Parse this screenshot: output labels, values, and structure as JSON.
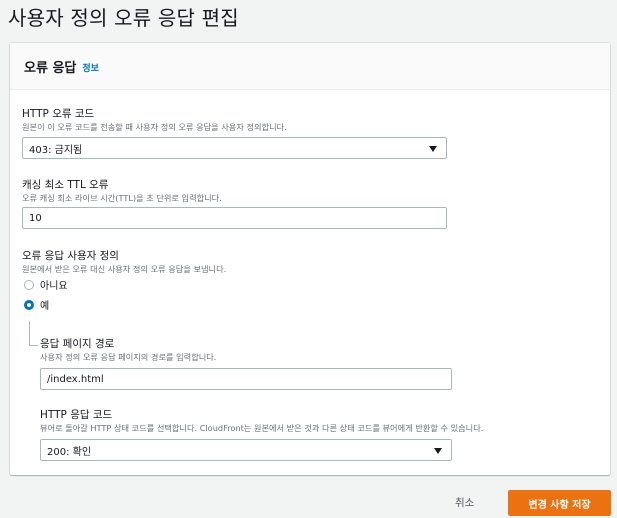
{
  "page": {
    "title": "사용자 정의 오류 응답 편집"
  },
  "panel": {
    "title": "오류 응답",
    "info_link": "정보"
  },
  "http_error_code": {
    "label": "HTTP 오류 코드",
    "description": "원본이 이 오류 코드를 전송할 때 사용자 정의 오류 응답을 사용자 정의합니다.",
    "selected": "403: 금지됨"
  },
  "min_ttl": {
    "label": "캐싱 최소 TTL 오류",
    "description": "오류 캐싱 최소 라이브 시간(TTL)을 초 단위로 입력합니다.",
    "value": "10"
  },
  "customize": {
    "label": "오류 응답 사용자 정의",
    "description": "원본에서 받은 오류 대신 사용자 정의 오류 응답을 보냅니다.",
    "options": [
      "아니요",
      "예"
    ],
    "selected": "예"
  },
  "response_page_path": {
    "label": "응답 페이지 경로",
    "description": "사용자 정의 오류 응답 페이지의 경로를 입력합니다.",
    "value": "/index.html"
  },
  "http_response_code": {
    "label": "HTTP 응답 코드",
    "description": "뷰어로 돌아갈 HTTP 상태 코드를 선택합니다. CloudFront는 원본에서 받은 것과 다른 상태 코드를 뷰어에게 반환할 수 있습니다.",
    "selected": "200: 확인"
  },
  "actions": {
    "cancel": "취소",
    "save": "변경 사항 저장"
  },
  "colors": {
    "primary": "#ec7211",
    "link": "#0073bb",
    "radio_selected": "#0073bb"
  }
}
